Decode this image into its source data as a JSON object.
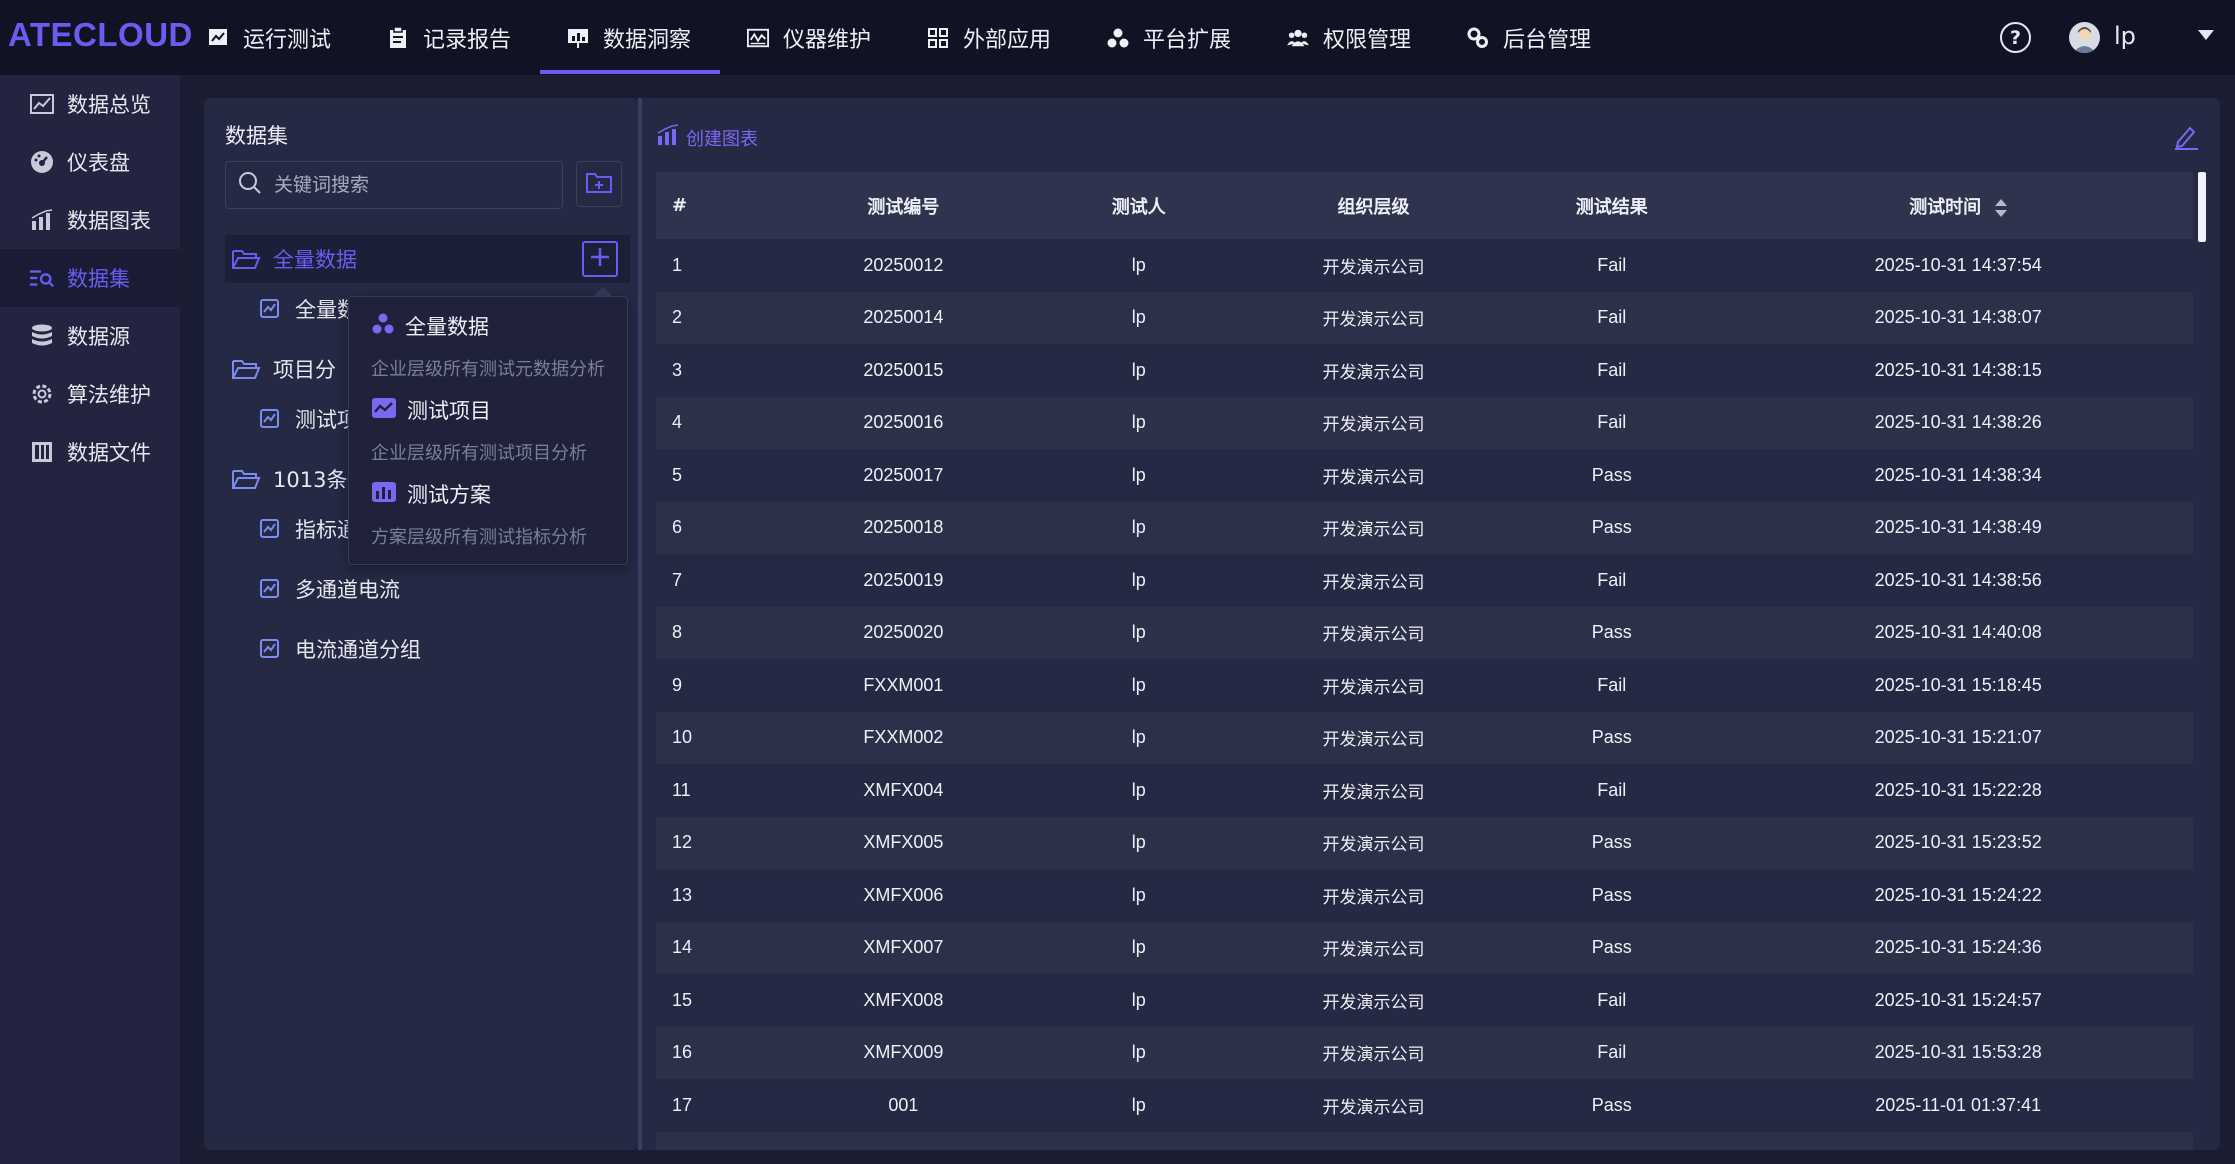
{
  "app": {
    "logo": "ATECLOUD"
  },
  "nav": {
    "items": [
      {
        "label": "运行测试",
        "icon": "chart-monitor-icon"
      },
      {
        "label": "记录报告",
        "icon": "clipboard-icon"
      },
      {
        "label": "数据洞察",
        "icon": "presentation-chart-icon",
        "active": true
      },
      {
        "label": "仪器维护",
        "icon": "instrument-icon"
      },
      {
        "label": "外部应用",
        "icon": "grid-apps-icon"
      },
      {
        "label": "平台扩展",
        "icon": "cluster-icon"
      },
      {
        "label": "权限管理",
        "icon": "users-icon"
      },
      {
        "label": "后台管理",
        "icon": "gears-icon"
      }
    ],
    "help": "?",
    "user": "lp",
    "accent": "#6b5cf0"
  },
  "sidebar": {
    "items": [
      {
        "label": "数据总览",
        "icon": "overview-icon"
      },
      {
        "label": "仪表盘",
        "icon": "dashboard-gauge-icon"
      },
      {
        "label": "数据图表",
        "icon": "bar-chart-icon"
      },
      {
        "label": "数据集",
        "icon": "dataset-search-icon",
        "active": true
      },
      {
        "label": "数据源",
        "icon": "database-icon"
      },
      {
        "label": "算法维护",
        "icon": "algorithm-gear-icon"
      },
      {
        "label": "数据文件",
        "icon": "data-file-icon"
      }
    ]
  },
  "dataset": {
    "title": "数据集",
    "search_placeholder": "关键词搜索",
    "tree": [
      {
        "label": "全量数据",
        "type": "folder",
        "active": true
      },
      {
        "label": "全量数",
        "type": "item"
      },
      {
        "label": "项目分",
        "type": "folder"
      },
      {
        "label": "测试项",
        "type": "item"
      },
      {
        "label": "1013条",
        "type": "folder"
      },
      {
        "label": "指标通",
        "type": "item"
      },
      {
        "label": "多通道电流",
        "type": "item"
      },
      {
        "label": "电流通道分组",
        "type": "item"
      }
    ],
    "popup": [
      {
        "label": "全量数据",
        "desc": "企业层级所有测试元数据分析",
        "icon": "cluster-icon"
      },
      {
        "label": "测试项目",
        "desc": "企业层级所有测试项目分析",
        "icon": "line-chart-icon"
      },
      {
        "label": "测试方案",
        "desc": "方案层级所有测试指标分析",
        "icon": "bar-chart-icon"
      }
    ]
  },
  "main": {
    "create_chart": "创建图表",
    "columns": [
      "#",
      "测试编号",
      "测试人",
      "组织层级",
      "测试结果",
      "测试时间"
    ],
    "rows": [
      [
        "1",
        "20250012",
        "lp",
        "开发演示公司",
        "Fail",
        "2025-10-31 14:37:54"
      ],
      [
        "2",
        "20250014",
        "lp",
        "开发演示公司",
        "Fail",
        "2025-10-31 14:38:07"
      ],
      [
        "3",
        "20250015",
        "lp",
        "开发演示公司",
        "Fail",
        "2025-10-31 14:38:15"
      ],
      [
        "4",
        "20250016",
        "lp",
        "开发演示公司",
        "Fail",
        "2025-10-31 14:38:26"
      ],
      [
        "5",
        "20250017",
        "lp",
        "开发演示公司",
        "Pass",
        "2025-10-31 14:38:34"
      ],
      [
        "6",
        "20250018",
        "lp",
        "开发演示公司",
        "Pass",
        "2025-10-31 14:38:49"
      ],
      [
        "7",
        "20250019",
        "lp",
        "开发演示公司",
        "Fail",
        "2025-10-31 14:38:56"
      ],
      [
        "8",
        "20250020",
        "lp",
        "开发演示公司",
        "Pass",
        "2025-10-31 14:40:08"
      ],
      [
        "9",
        "FXXM001",
        "lp",
        "开发演示公司",
        "Fail",
        "2025-10-31 15:18:45"
      ],
      [
        "10",
        "FXXM002",
        "lp",
        "开发演示公司",
        "Pass",
        "2025-10-31 15:21:07"
      ],
      [
        "11",
        "XMFX004",
        "lp",
        "开发演示公司",
        "Fail",
        "2025-10-31 15:22:28"
      ],
      [
        "12",
        "XMFX005",
        "lp",
        "开发演示公司",
        "Pass",
        "2025-10-31 15:23:52"
      ],
      [
        "13",
        "XMFX006",
        "lp",
        "开发演示公司",
        "Pass",
        "2025-10-31 15:24:22"
      ],
      [
        "14",
        "XMFX007",
        "lp",
        "开发演示公司",
        "Pass",
        "2025-10-31 15:24:36"
      ],
      [
        "15",
        "XMFX008",
        "lp",
        "开发演示公司",
        "Fail",
        "2025-10-31 15:24:57"
      ],
      [
        "16",
        "XMFX009",
        "lp",
        "开发演示公司",
        "Fail",
        "2025-10-31 15:53:28"
      ],
      [
        "17",
        "001",
        "lp",
        "开发演示公司",
        "Pass",
        "2025-11-01 01:37:41"
      ],
      [
        "",
        "",
        "",
        "",
        "",
        ""
      ]
    ]
  }
}
